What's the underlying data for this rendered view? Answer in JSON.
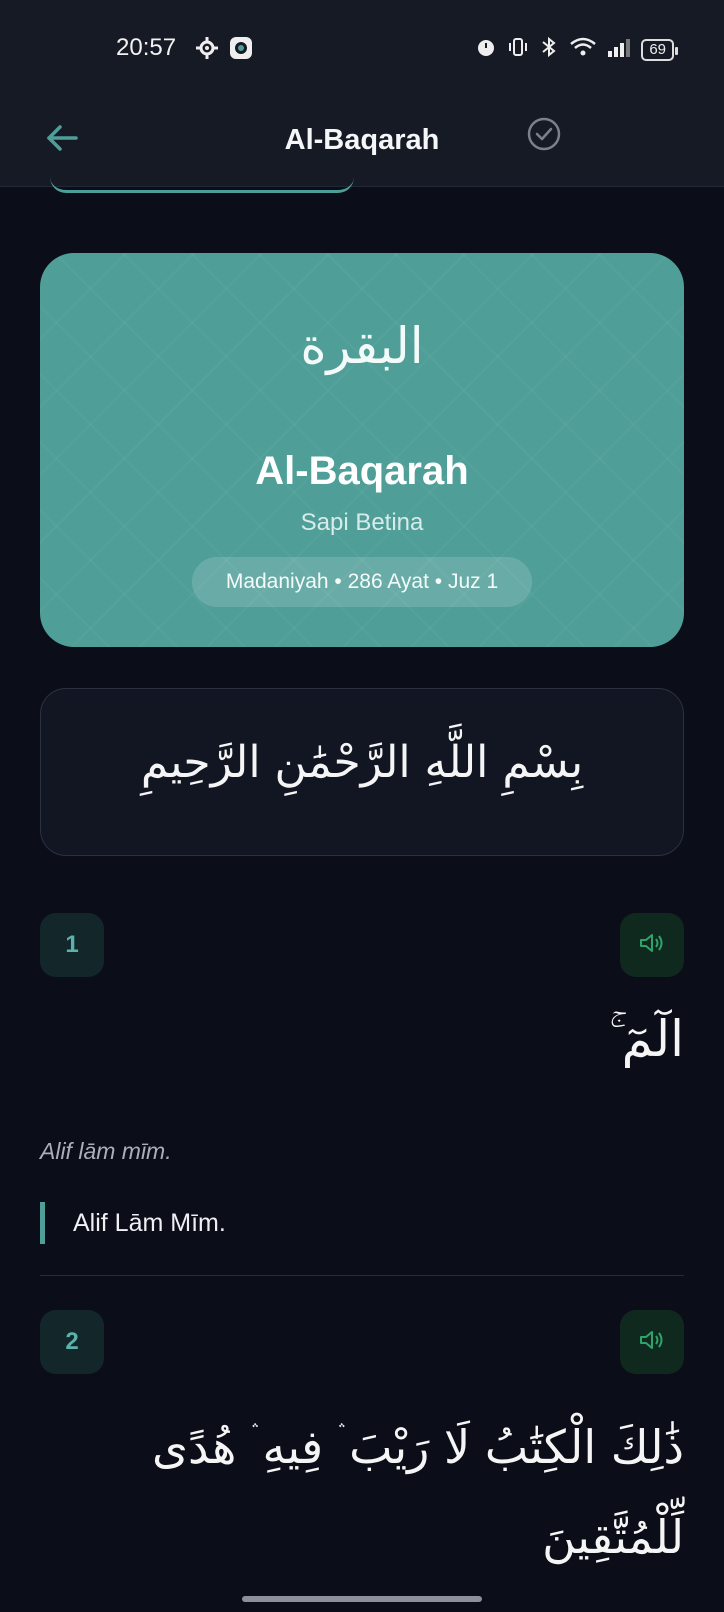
{
  "status_bar": {
    "time": "20:57",
    "battery": "69",
    "icons": [
      "settings-gear-icon",
      "app-notification-icon",
      "alarm-icon",
      "vibrate-icon",
      "bluetooth-icon",
      "wifi-icon",
      "signal-icon"
    ]
  },
  "app_bar": {
    "title": "Al-Baqarah",
    "back_icon": "arrow-left-icon",
    "action_icon": "check-circle-icon"
  },
  "surah_header": {
    "arabic_name": "البقرة",
    "latin_name": "Al-Baqarah",
    "meaning": "Sapi Betina",
    "info": "Madaniyah • 286 Ayat • Juz 1"
  },
  "bismillah": "بِسْمِ اللَّهِ الرَّحْمَٰنِ الرَّحِيمِ",
  "verses": [
    {
      "number": "1",
      "arabic": "الٓمٓ ۚ",
      "transliteration": "Alif lām mīm.",
      "translation": "Alif Lām Mīm."
    },
    {
      "number": "2",
      "arabic_line1": "ذَٰلِكَ الْكِتَٰبُ لَا رَيْبَ ۛ فِيهِ ۛ هُدًى",
      "arabic_line2": "لِّلْمُتَّقِينَ"
    }
  ],
  "colors": {
    "accent": "#4f9e98",
    "background": "#0b0e18",
    "bar": "#161a24"
  }
}
